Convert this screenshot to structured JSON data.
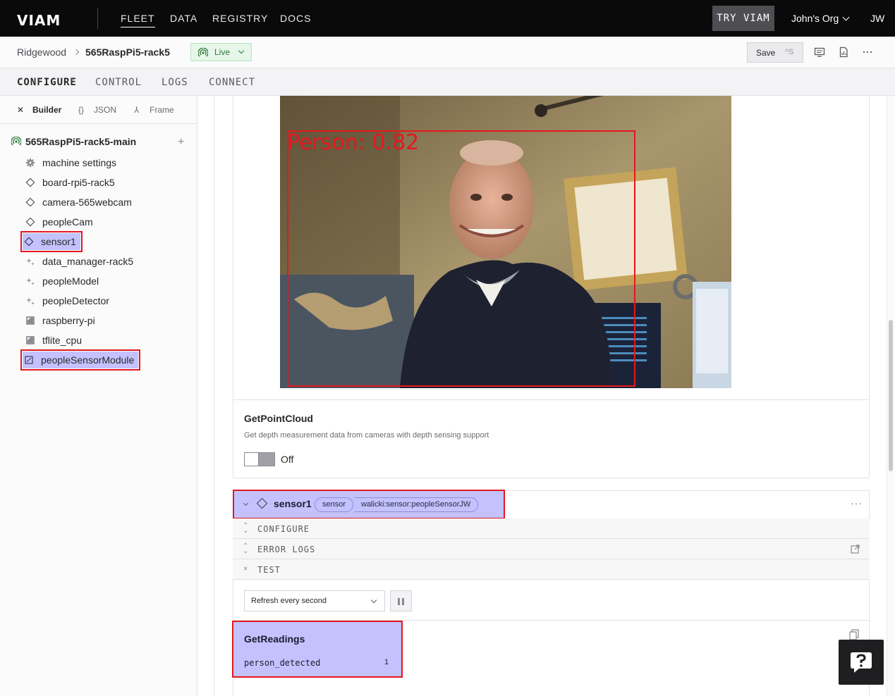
{
  "nav": {
    "logo": "VIAM",
    "links": [
      "FLEET",
      "DATA",
      "REGISTRY",
      "DOCS"
    ],
    "try_viam": "TRY VIAM",
    "org": "John's Org",
    "user_initials": "JW"
  },
  "breadcrumb": {
    "location": "Ridgewood",
    "machine": "565RaspPi5-rack5",
    "status": "Live",
    "save_label": "Save",
    "save_shortcut": "^S"
  },
  "tabs": [
    "CONFIGURE",
    "CONTROL",
    "LOGS",
    "CONNECT"
  ],
  "sidebar": {
    "modes": [
      "Builder",
      "JSON",
      "Frame"
    ],
    "root": "565RaspPi5-rack5-main",
    "items": [
      {
        "label": "machine settings",
        "icon": "gear-icon"
      },
      {
        "label": "board-rpi5-rack5",
        "icon": "component-icon"
      },
      {
        "label": "camera-565webcam",
        "icon": "component-icon"
      },
      {
        "label": "peopleCam",
        "icon": "component-icon"
      },
      {
        "label": "sensor1",
        "icon": "component-icon"
      },
      {
        "label": "data_manager-rack5",
        "icon": "service-icon"
      },
      {
        "label": "peopleModel",
        "icon": "service-icon"
      },
      {
        "label": "peopleDetector",
        "icon": "service-icon"
      },
      {
        "label": "raspberry-pi",
        "icon": "module-icon"
      },
      {
        "label": "tflite_cpu",
        "icon": "module-icon"
      },
      {
        "label": "peopleSensorModule",
        "icon": "module-icon"
      }
    ]
  },
  "camera": {
    "detection_label": "Person: 0.82"
  },
  "pointcloud": {
    "title": "GetPointCloud",
    "description": "Get depth measurement data from cameras with depth sensing support",
    "toggle_label": "Off"
  },
  "sensor": {
    "name": "sensor1",
    "type": "sensor",
    "model": "walicki:sensor:peopleSensorJW",
    "sections": [
      "CONFIGURE",
      "ERROR LOGS",
      "TEST"
    ],
    "refresh": "Refresh every second",
    "readings_title": "GetReadings",
    "reading_key": "person_detected",
    "reading_value": "1"
  },
  "colors": {
    "highlight": "#c3c2ff",
    "annotation_red": "#e5171f",
    "live_green": "#2f7a3b"
  }
}
